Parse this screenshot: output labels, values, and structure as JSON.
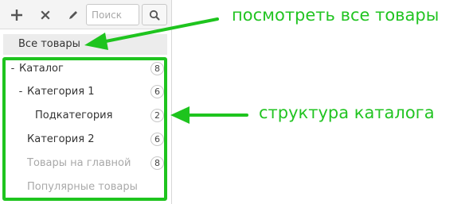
{
  "toolbar": {
    "add_icon": "plus-icon",
    "delete_icon": "close-icon",
    "edit_icon": "pencil-icon",
    "search_placeholder": "Поиск",
    "search_icon": "search-icon"
  },
  "all_products": {
    "label": "Все товары"
  },
  "tree": {
    "items": [
      {
        "toggle": "-",
        "label": "Каталог",
        "count": "8"
      },
      {
        "toggle": "-",
        "label": "Категория 1",
        "count": "6"
      },
      {
        "toggle": "",
        "label": "Подкатегория",
        "count": "2"
      },
      {
        "toggle": "",
        "label": "Категория 2",
        "count": "6"
      },
      {
        "toggle": "",
        "label": "Товары на главной",
        "count": "8"
      },
      {
        "toggle": "",
        "label": "Популярные товары",
        "count": ""
      }
    ]
  },
  "annotations": {
    "view_all": "посмотреть все товары",
    "catalog_structure": "структура каталога"
  },
  "colors": {
    "annotation_green": "#22c422",
    "highlight_green": "#1ec41e",
    "muted_text": "#a9a9a9"
  }
}
